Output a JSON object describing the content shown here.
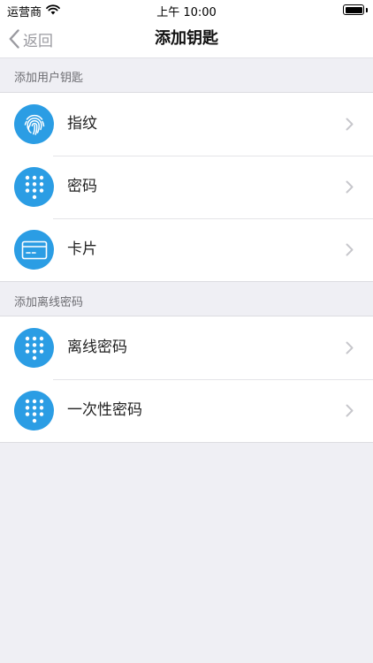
{
  "status_bar": {
    "carrier": "运营商",
    "time": "上午 10:00",
    "battery_level": 1.0
  },
  "nav": {
    "back_label": "返回",
    "title": "添加钥匙"
  },
  "sections": [
    {
      "header": "添加用户钥匙",
      "items": [
        {
          "label": "指纹",
          "icon": "fingerprint-icon"
        },
        {
          "label": "密码",
          "icon": "keypad-icon"
        },
        {
          "label": "卡片",
          "icon": "card-icon"
        }
      ]
    },
    {
      "header": "添加离线密码",
      "items": [
        {
          "label": "离线密码",
          "icon": "keypad-icon"
        },
        {
          "label": "一次性密码",
          "icon": "keypad-icon"
        }
      ]
    }
  ],
  "colors": {
    "accent": "#2b9de4",
    "background": "#efeff4",
    "chevron": "#c7c7cc"
  }
}
